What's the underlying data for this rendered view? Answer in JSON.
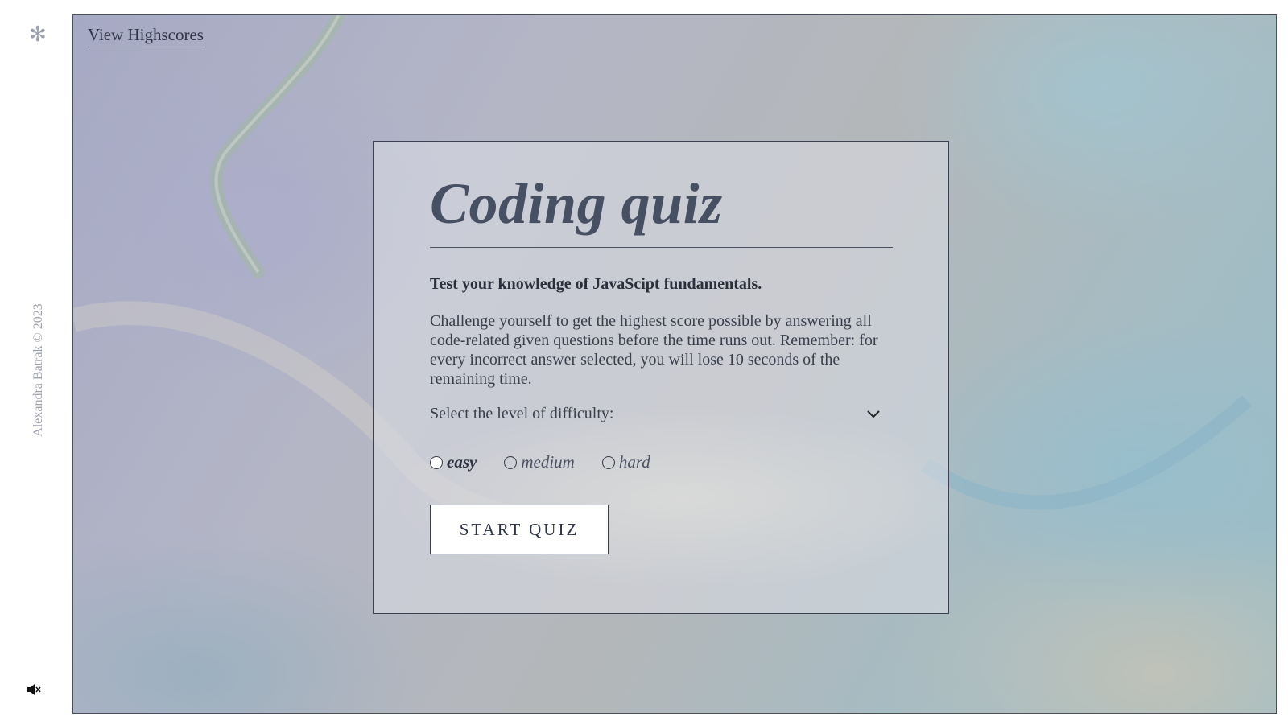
{
  "sidebar": {
    "asterisk_glyph": "✻",
    "copyright": "Alexandra Batrak © 2023",
    "sound_icon": "speaker-muted-icon"
  },
  "header": {
    "highscores_link": "View Highscores"
  },
  "card": {
    "title": "Coding quiz",
    "subtitle": "Test your knowledge of JavaScipt fundamentals.",
    "description": "Challenge yourself to get the highest score possible by answering all code-related given questions before the time runs out. Remember: for every incorrect answer selected, you will lose 10 seconds of the remaining time.",
    "difficulty_prompt": "Select the level of difficulty:",
    "difficulty_options": [
      {
        "label": "easy",
        "selected": false
      },
      {
        "label": "medium",
        "selected": false
      },
      {
        "label": "hard",
        "selected": false
      }
    ],
    "start_button": "START QUIZ"
  },
  "colors": {
    "title": "#475063",
    "text": "#3a3f4c",
    "border": "#3b4152"
  }
}
